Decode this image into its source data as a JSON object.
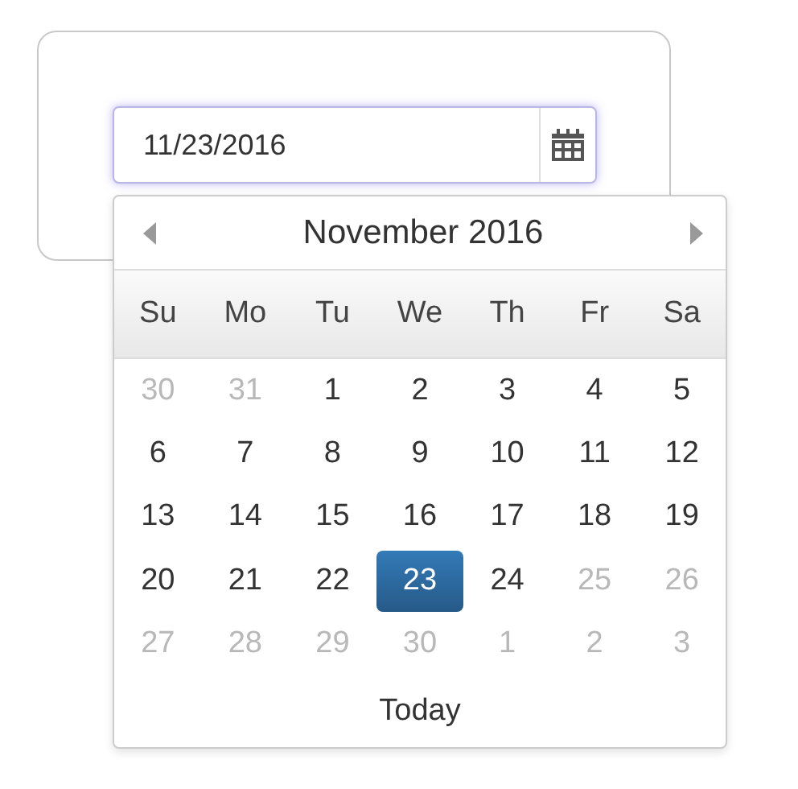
{
  "date_field": {
    "value": "11/23/2016"
  },
  "calendar": {
    "title": "November 2016",
    "weekdays": [
      "Su",
      "Mo",
      "Tu",
      "We",
      "Th",
      "Fr",
      "Sa"
    ],
    "weeks": [
      [
        {
          "label": "30",
          "muted": true,
          "selected": false
        },
        {
          "label": "31",
          "muted": true,
          "selected": false
        },
        {
          "label": "1",
          "muted": false,
          "selected": false
        },
        {
          "label": "2",
          "muted": false,
          "selected": false
        },
        {
          "label": "3",
          "muted": false,
          "selected": false
        },
        {
          "label": "4",
          "muted": false,
          "selected": false
        },
        {
          "label": "5",
          "muted": false,
          "selected": false
        }
      ],
      [
        {
          "label": "6",
          "muted": false,
          "selected": false
        },
        {
          "label": "7",
          "muted": false,
          "selected": false
        },
        {
          "label": "8",
          "muted": false,
          "selected": false
        },
        {
          "label": "9",
          "muted": false,
          "selected": false
        },
        {
          "label": "10",
          "muted": false,
          "selected": false
        },
        {
          "label": "11",
          "muted": false,
          "selected": false
        },
        {
          "label": "12",
          "muted": false,
          "selected": false
        }
      ],
      [
        {
          "label": "13",
          "muted": false,
          "selected": false
        },
        {
          "label": "14",
          "muted": false,
          "selected": false
        },
        {
          "label": "15",
          "muted": false,
          "selected": false
        },
        {
          "label": "16",
          "muted": false,
          "selected": false
        },
        {
          "label": "17",
          "muted": false,
          "selected": false
        },
        {
          "label": "18",
          "muted": false,
          "selected": false
        },
        {
          "label": "19",
          "muted": false,
          "selected": false
        }
      ],
      [
        {
          "label": "20",
          "muted": false,
          "selected": false
        },
        {
          "label": "21",
          "muted": false,
          "selected": false
        },
        {
          "label": "22",
          "muted": false,
          "selected": false
        },
        {
          "label": "23",
          "muted": false,
          "selected": true
        },
        {
          "label": "24",
          "muted": false,
          "selected": false
        },
        {
          "label": "25",
          "muted": true,
          "selected": false
        },
        {
          "label": "26",
          "muted": true,
          "selected": false
        }
      ],
      [
        {
          "label": "27",
          "muted": true,
          "selected": false
        },
        {
          "label": "28",
          "muted": true,
          "selected": false
        },
        {
          "label": "29",
          "muted": true,
          "selected": false
        },
        {
          "label": "30",
          "muted": true,
          "selected": false
        },
        {
          "label": "1",
          "muted": true,
          "selected": false
        },
        {
          "label": "2",
          "muted": true,
          "selected": false
        },
        {
          "label": "3",
          "muted": true,
          "selected": false
        }
      ]
    ],
    "today_button": "Today"
  }
}
